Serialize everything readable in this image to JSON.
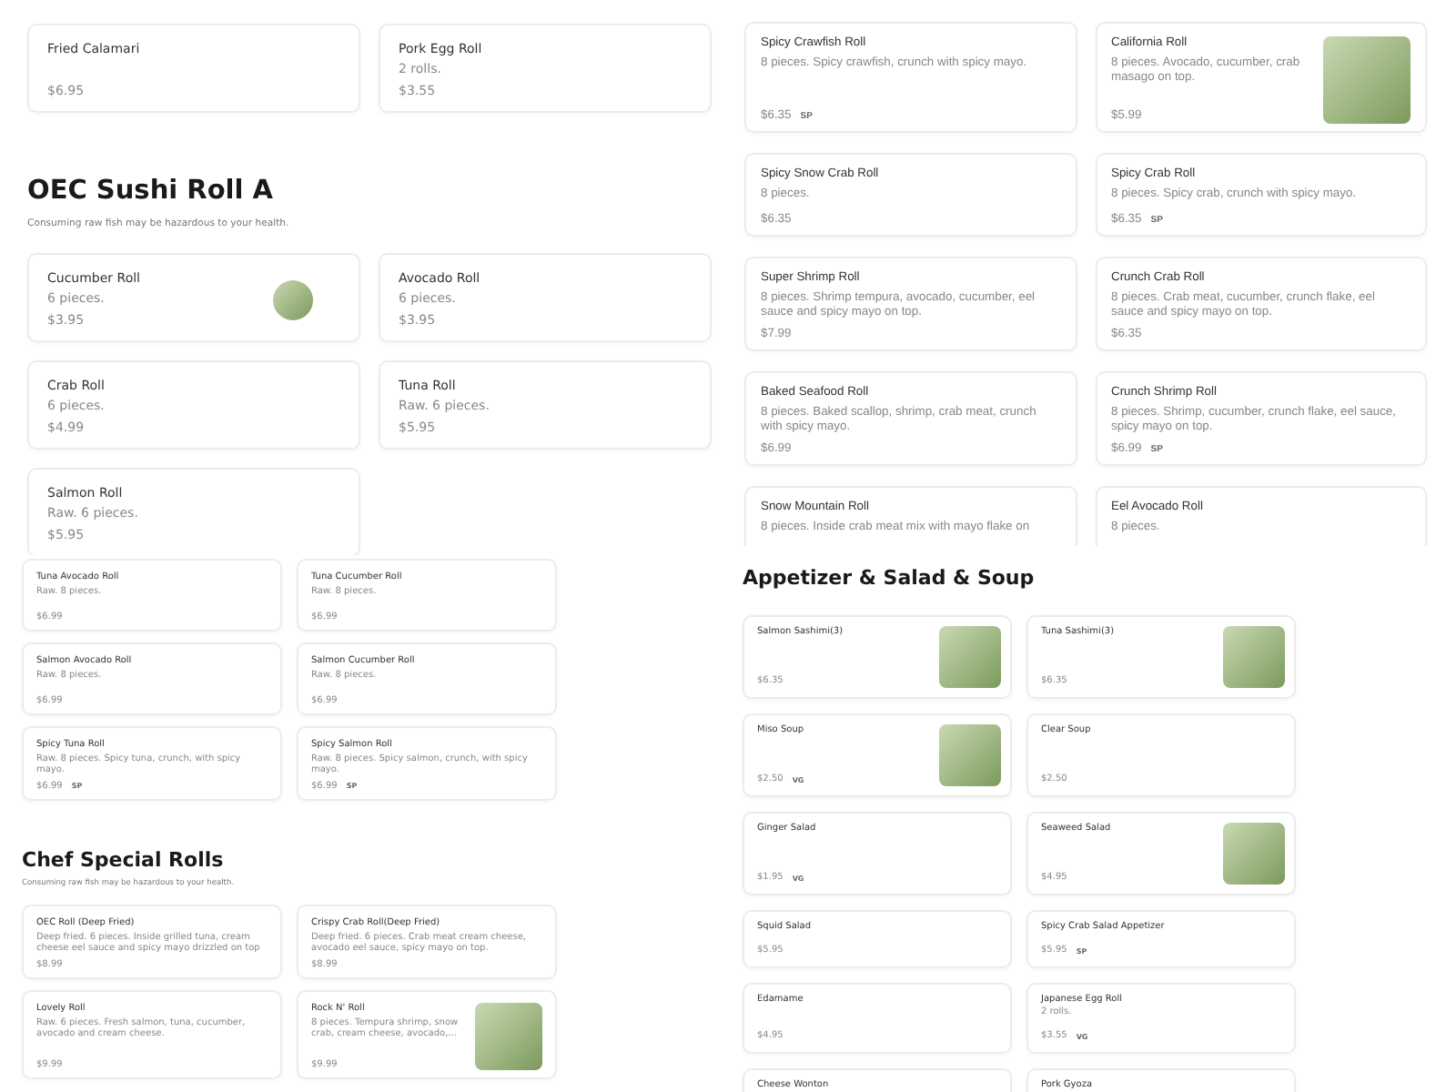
{
  "panels": [
    {
      "sections": [
        {
          "items": [
            {
              "name": "Fried Calamari",
              "price": "$6.95",
              "photo": false
            },
            {
              "name": "Pork Egg Roll",
              "description": "2 rolls.",
              "price": "$3.55",
              "photo": false
            }
          ]
        },
        {
          "title": "OEC Sushi Roll A",
          "note": "Consuming raw fish may be hazardous to your health.",
          "items": [
            {
              "name": "Cucumber Roll",
              "description": "6 pieces.",
              "price": "$3.95",
              "photo": true
            },
            {
              "name": "Avocado Roll",
              "description": "6 pieces.",
              "price": "$3.95",
              "photo": false
            },
            {
              "name": "Crab Roll",
              "description": "6 pieces.",
              "price": "$4.99",
              "photo": false
            },
            {
              "name": "Tuna Roll",
              "description": "Raw. 6 pieces.",
              "price": "$5.95",
              "photo": false
            },
            {
              "name": "Salmon Roll",
              "description": "Raw. 6 pieces.",
              "price": "$5.95",
              "photo": false
            }
          ]
        }
      ]
    },
    {
      "sections": [
        {
          "items": [
            {
              "name": "Spicy Crawfish Roll",
              "description": "8 pieces. Spicy crawfish, crunch with spicy mayo.",
              "price": "$6.35",
              "tag": "SP",
              "photo": false
            },
            {
              "name": "California Roll",
              "description": "8 pieces. Avocado, cucumber, crab masago on top.",
              "price": "$5.99",
              "photo": true
            },
            {
              "name": "Spicy Snow Crab Roll",
              "description": "8 pieces.",
              "price": "$6.35",
              "photo": false
            },
            {
              "name": "Spicy Crab Roll",
              "description": "8 pieces. Spicy crab, crunch with spicy mayo.",
              "price": "$6.35",
              "tag": "SP",
              "photo": false
            },
            {
              "name": "Super Shrimp Roll",
              "description": "8 pieces. Shrimp tempura, avocado, cucumber, eel sauce and spicy mayo on top.",
              "price": "$7.99",
              "photo": false
            },
            {
              "name": "Crunch Crab Roll",
              "description": "8 pieces. Crab meat, cucumber, crunch flake, eel sauce and spicy mayo on top.",
              "price": "$6.35",
              "photo": false
            },
            {
              "name": "Baked Seafood Roll",
              "description": "8 pieces. Baked scallop, shrimp, crab meat, crunch with spicy mayo.",
              "price": "$6.99",
              "photo": false
            },
            {
              "name": "Crunch Shrimp Roll",
              "description": "8 pieces. Shrimp, cucumber, crunch flake, eel sauce, spicy mayo on top.",
              "price": "$6.99",
              "tag": "SP",
              "photo": false
            },
            {
              "name": "Snow Mountain Roll",
              "description": "8 pieces. Inside crab meat mix with mayo flake on",
              "photo": false
            },
            {
              "name": "Eel Avocado Roll",
              "description": "8 pieces.",
              "photo": false
            }
          ]
        }
      ]
    },
    {
      "sections": [
        {
          "items": [
            {
              "name": "Tuna Avocado Roll",
              "description": "Raw. 8 pieces.",
              "price": "$6.99",
              "photo": false
            },
            {
              "name": "Tuna Cucumber Roll",
              "description": "Raw. 8 pieces.",
              "price": "$6.99",
              "photo": false
            },
            {
              "name": "Salmon Avocado Roll",
              "description": "Raw. 8 pieces.",
              "price": "$6.99",
              "photo": false
            },
            {
              "name": "Salmon Cucumber Roll",
              "description": "Raw. 8 pieces.",
              "price": "$6.99",
              "photo": false
            },
            {
              "name": "Spicy Tuna Roll",
              "description": "Raw. 8 pieces. Spicy tuna, crunch, with spicy mayo.",
              "price": "$6.99",
              "tag": "SP",
              "photo": false
            },
            {
              "name": "Spicy Salmon Roll",
              "description": "Raw. 8 pieces. Spicy salmon, crunch, with spicy mayo.",
              "price": "$6.99",
              "tag": "SP",
              "photo": false
            }
          ]
        },
        {
          "title": "Chef Special Rolls",
          "note": "Consuming raw fish may be hazardous to your health.",
          "items": [
            {
              "name": "OEC Roll (Deep Fried)",
              "description": "Deep fried. 6 pieces. Inside grilled tuna, cream cheese eel sauce and spicy mayo drizzled on top",
              "price": "$8.99",
              "photo": false
            },
            {
              "name": "Crispy Crab Roll(Deep Fried)",
              "description": "Deep fried. 6 pieces. Crab meat cream cheese, avocado eel sauce, spicy mayo on top.",
              "price": "$8.99",
              "photo": false
            },
            {
              "name": "Lovely Roll",
              "description": "Raw. 6 pieces. Fresh salmon, tuna, cucumber, avocado and cream cheese.",
              "price": "$9.99",
              "photo": false
            },
            {
              "name": "Rock N' Roll",
              "description": "8 pieces. Tempura shrimp, snow crab, cream cheese, avocado,...",
              "price": "$9.99",
              "photo": true
            }
          ]
        }
      ]
    },
    {
      "sections": [
        {
          "title": "Appetizer & Salad & Soup",
          "items": [
            {
              "name": "Salmon Sashimi(3)",
              "price": "$6.35",
              "photo": true
            },
            {
              "name": "Tuna Sashimi(3)",
              "price": "$6.35",
              "photo": true
            },
            {
              "name": "Miso Soup",
              "price": "$2.50",
              "tag": "VG",
              "photo": true
            },
            {
              "name": "Clear Soup",
              "price": "$2.50",
              "photo": false
            },
            {
              "name": "Ginger Salad",
              "price": "$1.95",
              "tag": "VG",
              "photo": false
            },
            {
              "name": "Seaweed Salad",
              "price": "$4.95",
              "photo": true
            },
            {
              "name": "Squid Salad",
              "price": "$5.95",
              "photo": false
            },
            {
              "name": "Spicy Crab Salad Appetizer",
              "price": "$5.95",
              "tag": "SP",
              "photo": false
            },
            {
              "name": "Edamame",
              "price": "$4.95",
              "photo": false
            },
            {
              "name": "Japanese Egg Roll",
              "description": "2 rolls.",
              "price": "$3.55",
              "tag": "VG",
              "photo": false
            },
            {
              "name": "Cheese Wonton",
              "photo": false
            },
            {
              "name": "Pork Gyoza",
              "photo": false
            }
          ]
        }
      ]
    }
  ]
}
